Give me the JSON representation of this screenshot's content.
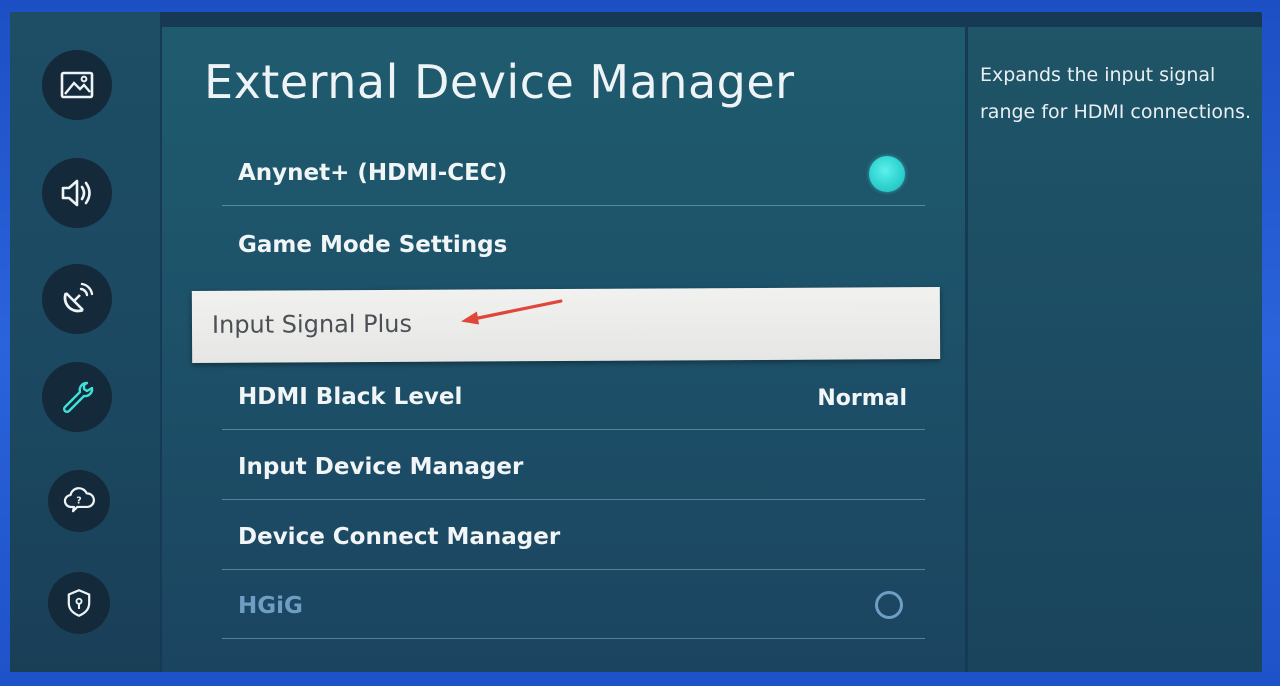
{
  "title": "External Device Manager",
  "description": "Expands the input signal range for HDMI connections.",
  "sidebar": [
    {
      "icon": "picture-icon"
    },
    {
      "icon": "sound-icon"
    },
    {
      "icon": "broadcasting-icon"
    },
    {
      "icon": "general-wrench-icon"
    },
    {
      "icon": "support-icon"
    },
    {
      "icon": "privacy-shield-icon"
    }
  ],
  "menu": {
    "anynet": {
      "label": "Anynet+ (HDMI-CEC)",
      "toggle": true
    },
    "game_mode": {
      "label": "Game Mode Settings"
    },
    "input_signal_plus": {
      "label": "Input Signal Plus"
    },
    "hdmi_black_level": {
      "label": "HDMI Black Level",
      "value": "Normal"
    },
    "input_device_manager": {
      "label": "Input Device Manager"
    },
    "device_connect_manager": {
      "label": "Device Connect Manager"
    },
    "hgig": {
      "label": "HGiG",
      "toggle": false
    }
  },
  "colors": {
    "accent": "#2ed3d0",
    "annotation_arrow": "#e0473a"
  }
}
